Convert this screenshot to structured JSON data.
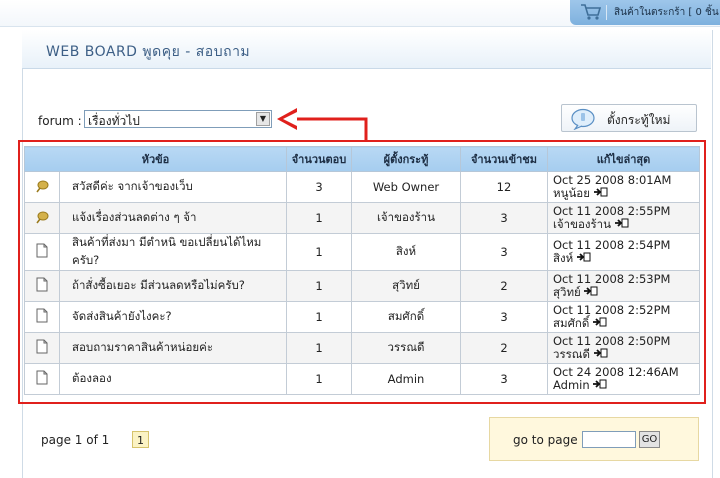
{
  "topbar": {
    "cart_label": "สินค้าในตระกร้า [ 0 ชิ้น"
  },
  "page": {
    "title": "WEB BOARD พูดคุย - สอบถาม"
  },
  "forum": {
    "label": "forum :",
    "selected": "เรื่องทั่วไป"
  },
  "new_topic": {
    "label": "ตั้งกระทู้ใหม่"
  },
  "table": {
    "headers": [
      "หัวข้อ",
      "จำนวนตอบ",
      "ผู้ตั้งกระทู้",
      "จำนวนเข้าชม",
      "แก้ไขล่าสุด"
    ],
    "rows": [
      {
        "icon": "hot-folder-icon",
        "title": "สวัสดีค่ะ จากเจ้าของเว็บ",
        "replies": "3",
        "owner": "Web Owner",
        "views": "12",
        "last_date": "Oct 25 2008 8:01AM",
        "last_user": "หนูน้อย"
      },
      {
        "icon": "hot-folder-icon",
        "title": "แจ้งเรื่องส่วนลดต่าง ๆ จ้า",
        "replies": "1",
        "owner": "เจ้าของร้าน",
        "views": "3",
        "last_date": "Oct 11 2008 2:55PM",
        "last_user": "เจ้าของร้าน"
      },
      {
        "icon": "document-icon",
        "title": "สินค้าที่ส่งมา มีตำหนิ ขอเปลี่ยนได้ไหมครับ?",
        "replies": "1",
        "owner": "สิงห์",
        "views": "3",
        "last_date": "Oct 11 2008 2:54PM",
        "last_user": "สิงห์"
      },
      {
        "icon": "document-icon",
        "title": "ถ้าสั่งซื้อเยอะ มีส่วนลดหรือไม่ครับ?",
        "replies": "1",
        "owner": "สุวิทย์",
        "views": "2",
        "last_date": "Oct 11 2008 2:53PM",
        "last_user": "สุวิทย์"
      },
      {
        "icon": "document-icon",
        "title": "จัดส่งสินค้ายังไงคะ?",
        "replies": "1",
        "owner": "สมศักดิ์",
        "views": "3",
        "last_date": "Oct 11 2008 2:52PM",
        "last_user": "สมศักดิ์"
      },
      {
        "icon": "document-icon",
        "title": "สอบถามราคาสินค้าหน่อยค่ะ",
        "replies": "1",
        "owner": "วรรณดี",
        "views": "2",
        "last_date": "Oct 11 2008 2:50PM",
        "last_user": "วรรณดี"
      },
      {
        "icon": "document-icon",
        "title": "ต้องลอง",
        "replies": "1",
        "owner": "Admin",
        "views": "3",
        "last_date": "Oct 24 2008 12:46AM",
        "last_user": "Admin"
      }
    ]
  },
  "pager": {
    "text": "page 1 of 1",
    "current": "1"
  },
  "goto": {
    "label": "go to page",
    "value": "",
    "button": "GO"
  },
  "colors": {
    "annotation_red": "#e0201c",
    "header_blue": "#a5cdef",
    "title_blue": "#3d5f86"
  }
}
